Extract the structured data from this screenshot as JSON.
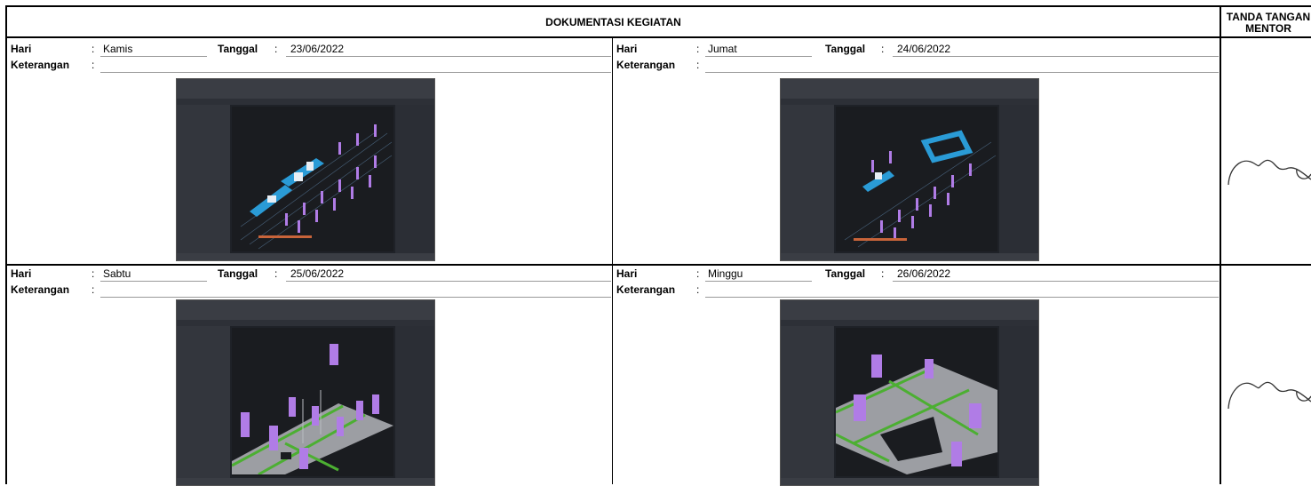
{
  "header": {
    "title": "DOKUMENTASI KEGIATAN",
    "sign_title_line1": "TANDA TANGAN",
    "sign_title_line2": "MENTOR"
  },
  "labels": {
    "hari": "Hari",
    "tanggal": "Tanggal",
    "keterangan": "Keterangan",
    "colon": ":"
  },
  "entries": [
    {
      "hari": "Kamis",
      "tanggal": "23/06/2022",
      "keterangan": ""
    },
    {
      "hari": "Jumat",
      "tanggal": "24/06/2022",
      "keterangan": ""
    },
    {
      "hari": "Sabtu",
      "tanggal": "25/06/2022",
      "keterangan": ""
    },
    {
      "hari": "Minggu",
      "tanggal": "26/06/2022",
      "keterangan": ""
    }
  ],
  "colors": {
    "border": "#000000",
    "model_blue": "#2a9bd6",
    "model_purple": "#b07ce6",
    "model_green": "#4caf32",
    "model_gray": "#9c9ea3",
    "app_dark": "#1f2228"
  }
}
